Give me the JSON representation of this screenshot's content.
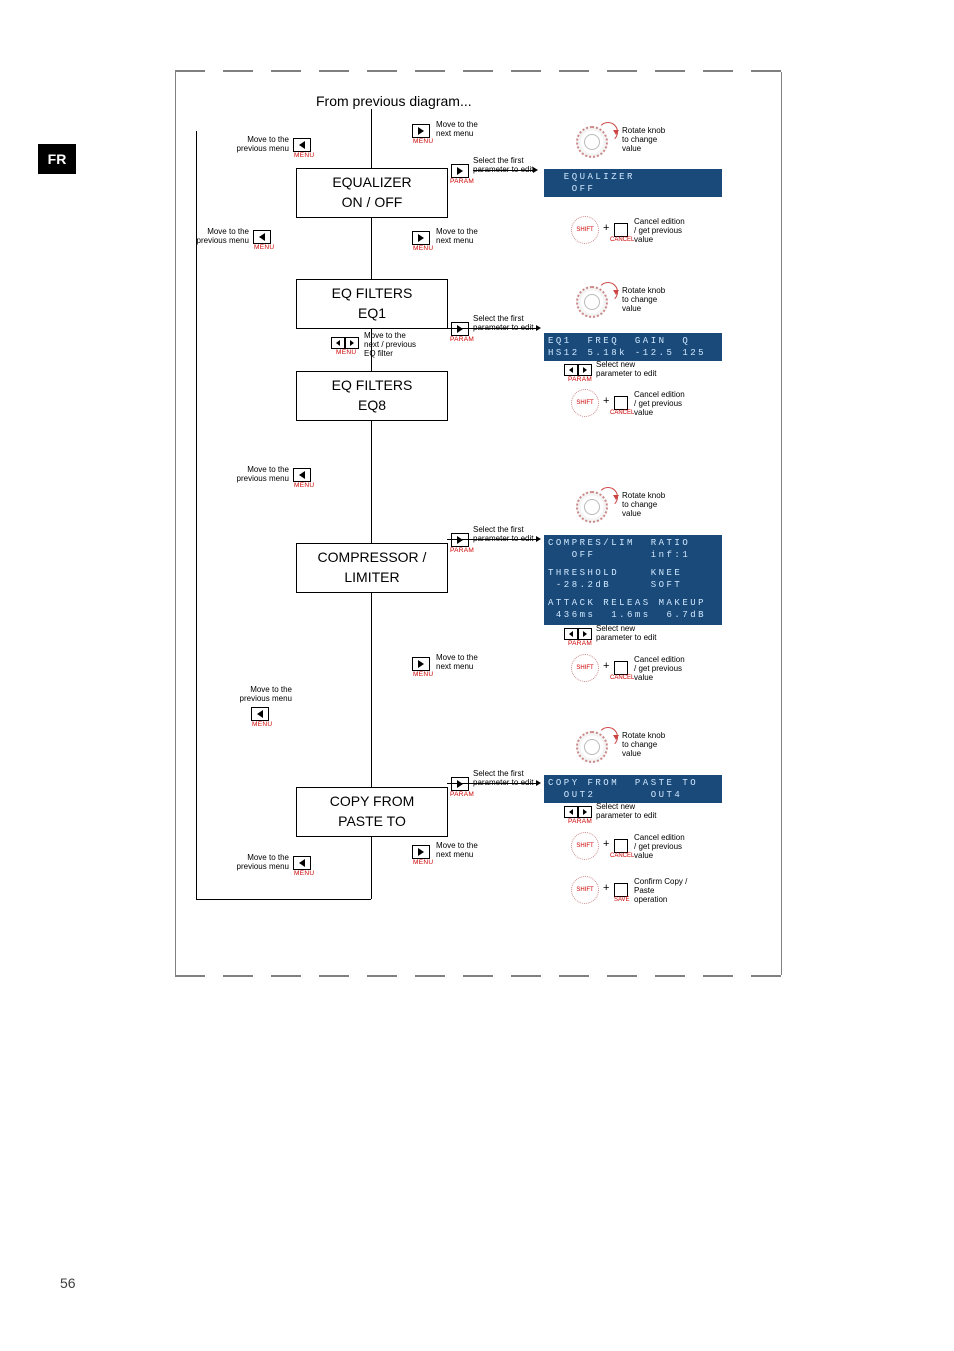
{
  "page": {
    "language_tab": "FR",
    "page_number": "56"
  },
  "diagram": {
    "title": "From previous diagram...",
    "labels": {
      "move_prev_menu": "Move to the\nprevious menu",
      "move_next_menu": "Move to the\nnext menu",
      "move_next_prev_filter": "Move to the\nnext / previous\nEQ filter",
      "select_first_param": "Select the first\nparameter to edit",
      "select_new_param": "Select new\nparameter to edit",
      "rotate_knob": "Rotate knob\nto change\nvalue",
      "cancel_edit": "Cancel edition\n/ get previous\nvalue",
      "confirm_copy": "Confirm Copy /\nPaste\noperation",
      "btn_menu": "MENU",
      "btn_param": "PARAM",
      "btn_cancel": "CANCEL",
      "btn_save": "SAVE",
      "shift": "SHIFT",
      "plus": "+"
    },
    "menus": {
      "equalizer": {
        "line1": "EQUALIZER",
        "line2": "ON / OFF"
      },
      "eq_filters_1": {
        "line1": "EQ FILTERS",
        "line2": "EQ1"
      },
      "eq_filters_8": {
        "line1": "EQ FILTERS",
        "line2": "EQ8"
      },
      "compressor": {
        "line1": "COMPRESSOR /",
        "line2": "LIMITER"
      },
      "copy_paste": {
        "line1": "COPY FROM",
        "line2": "PASTE TO"
      }
    },
    "lcd": {
      "equalizer": {
        "r1": "  EQUALIZER",
        "r2": "   OFF"
      },
      "eq_filter": {
        "r1": "EQ1  FREQ  GAIN  Q",
        "r2": "HS12 5.18k -12.5 125"
      },
      "compressor": {
        "r1": "COMPRES/LIM  RATIO",
        "r2": "   OFF       inf:1",
        "r3": "THRESHOLD    KNEE",
        "r4": " -28.2dB     SOFT",
        "r5": "ATTACK RELEAS MAKEUP",
        "r6": " 436ms  1.6ms  6.7dB"
      },
      "copy": {
        "r1": "COPY FROM  PASTE TO",
        "r2": "  OUT2       OUT4"
      }
    }
  }
}
